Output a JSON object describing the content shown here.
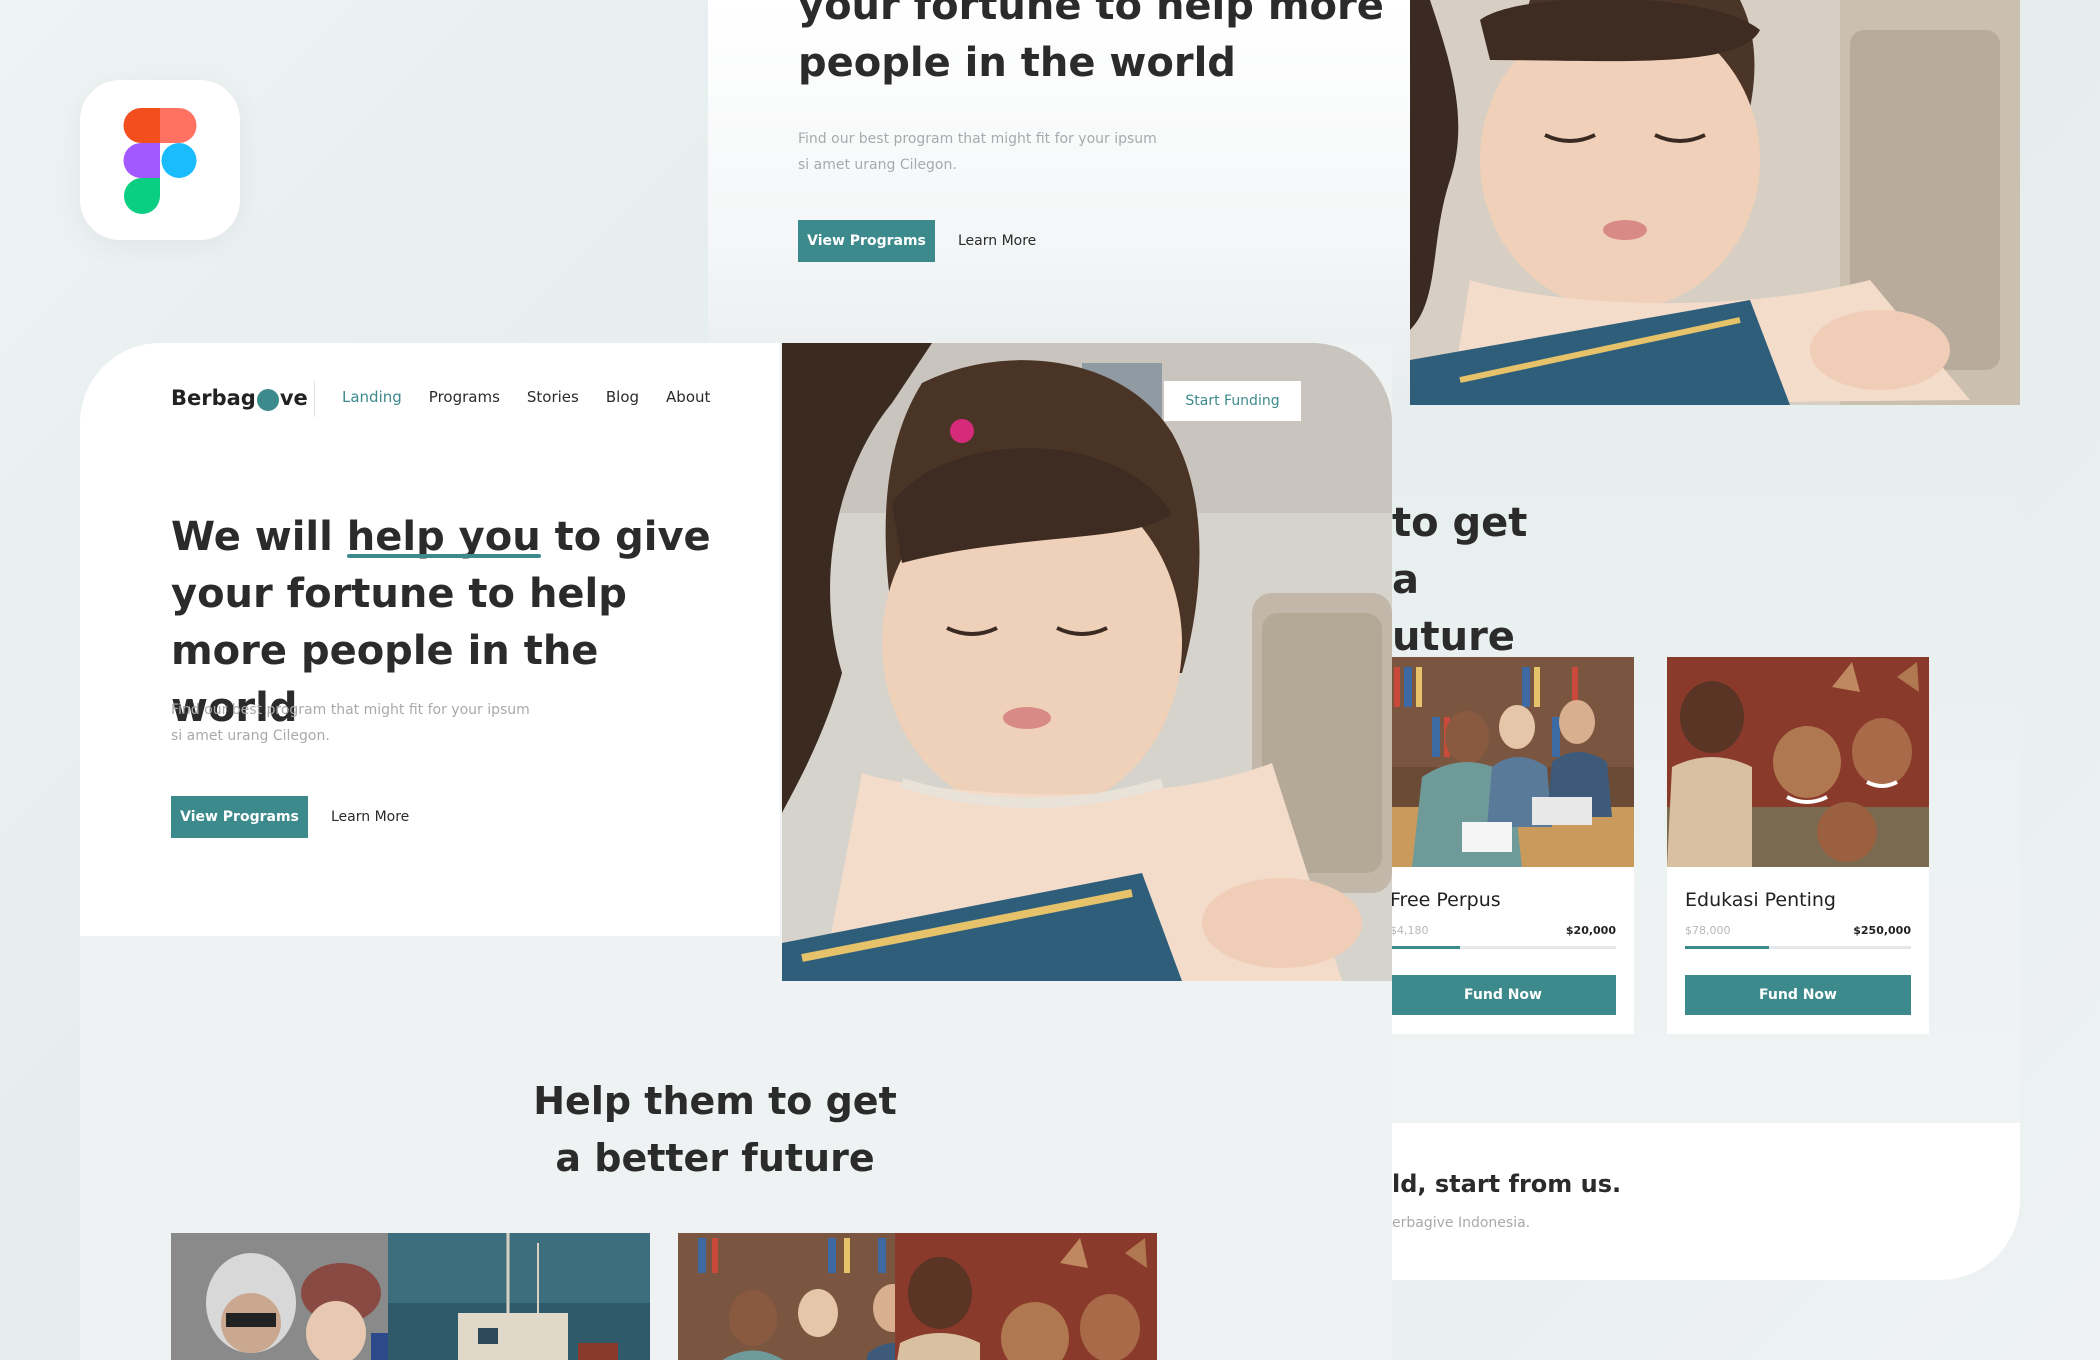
{
  "figma_icon": "figma-logo-icon",
  "brand": {
    "name_prefix": "Berbag",
    "name_suffix": "ve",
    "dot_letter": "i"
  },
  "nav": {
    "items": [
      "Landing",
      "Programs",
      "Stories",
      "Blog",
      "About"
    ],
    "active": "Landing",
    "cta": "Start Funding"
  },
  "hero": {
    "title_pre": "We will ",
    "title_highlight": "help you",
    "title_post": " to give your fortune to help more people in the world",
    "subtitle": "Find our best program that might fit for your ipsum si amet urang Cilegon.",
    "primary_button": "View Programs",
    "secondary_button": "Learn More"
  },
  "back_top": {
    "title": "your fortune to help more people in the world",
    "subtitle": "Find our best program that might fit for your ipsum si amet urang Cilegon.",
    "primary_button": "View Programs",
    "secondary_button": "Learn More"
  },
  "back_right": {
    "heading": "to get a uture",
    "cta_title": "ld, start from us.",
    "cta_sub": "erbagive Indonesia."
  },
  "programs_section": {
    "title": "Help them to get a better future"
  },
  "program_cards": [
    {
      "title": "Free Perpus",
      "raised": "$4,180",
      "goal": "$20,000",
      "progress": 0.31,
      "button": "Fund Now"
    },
    {
      "title": "Edukasi Penting",
      "raised": "$78,000",
      "goal": "$250,000",
      "progress": 0.37,
      "button": "Fund Now"
    }
  ],
  "colors": {
    "accent": "#3d8a8c",
    "text": "#2b2b2b",
    "muted": "#a7aaad",
    "background": "#eff2f3"
  }
}
